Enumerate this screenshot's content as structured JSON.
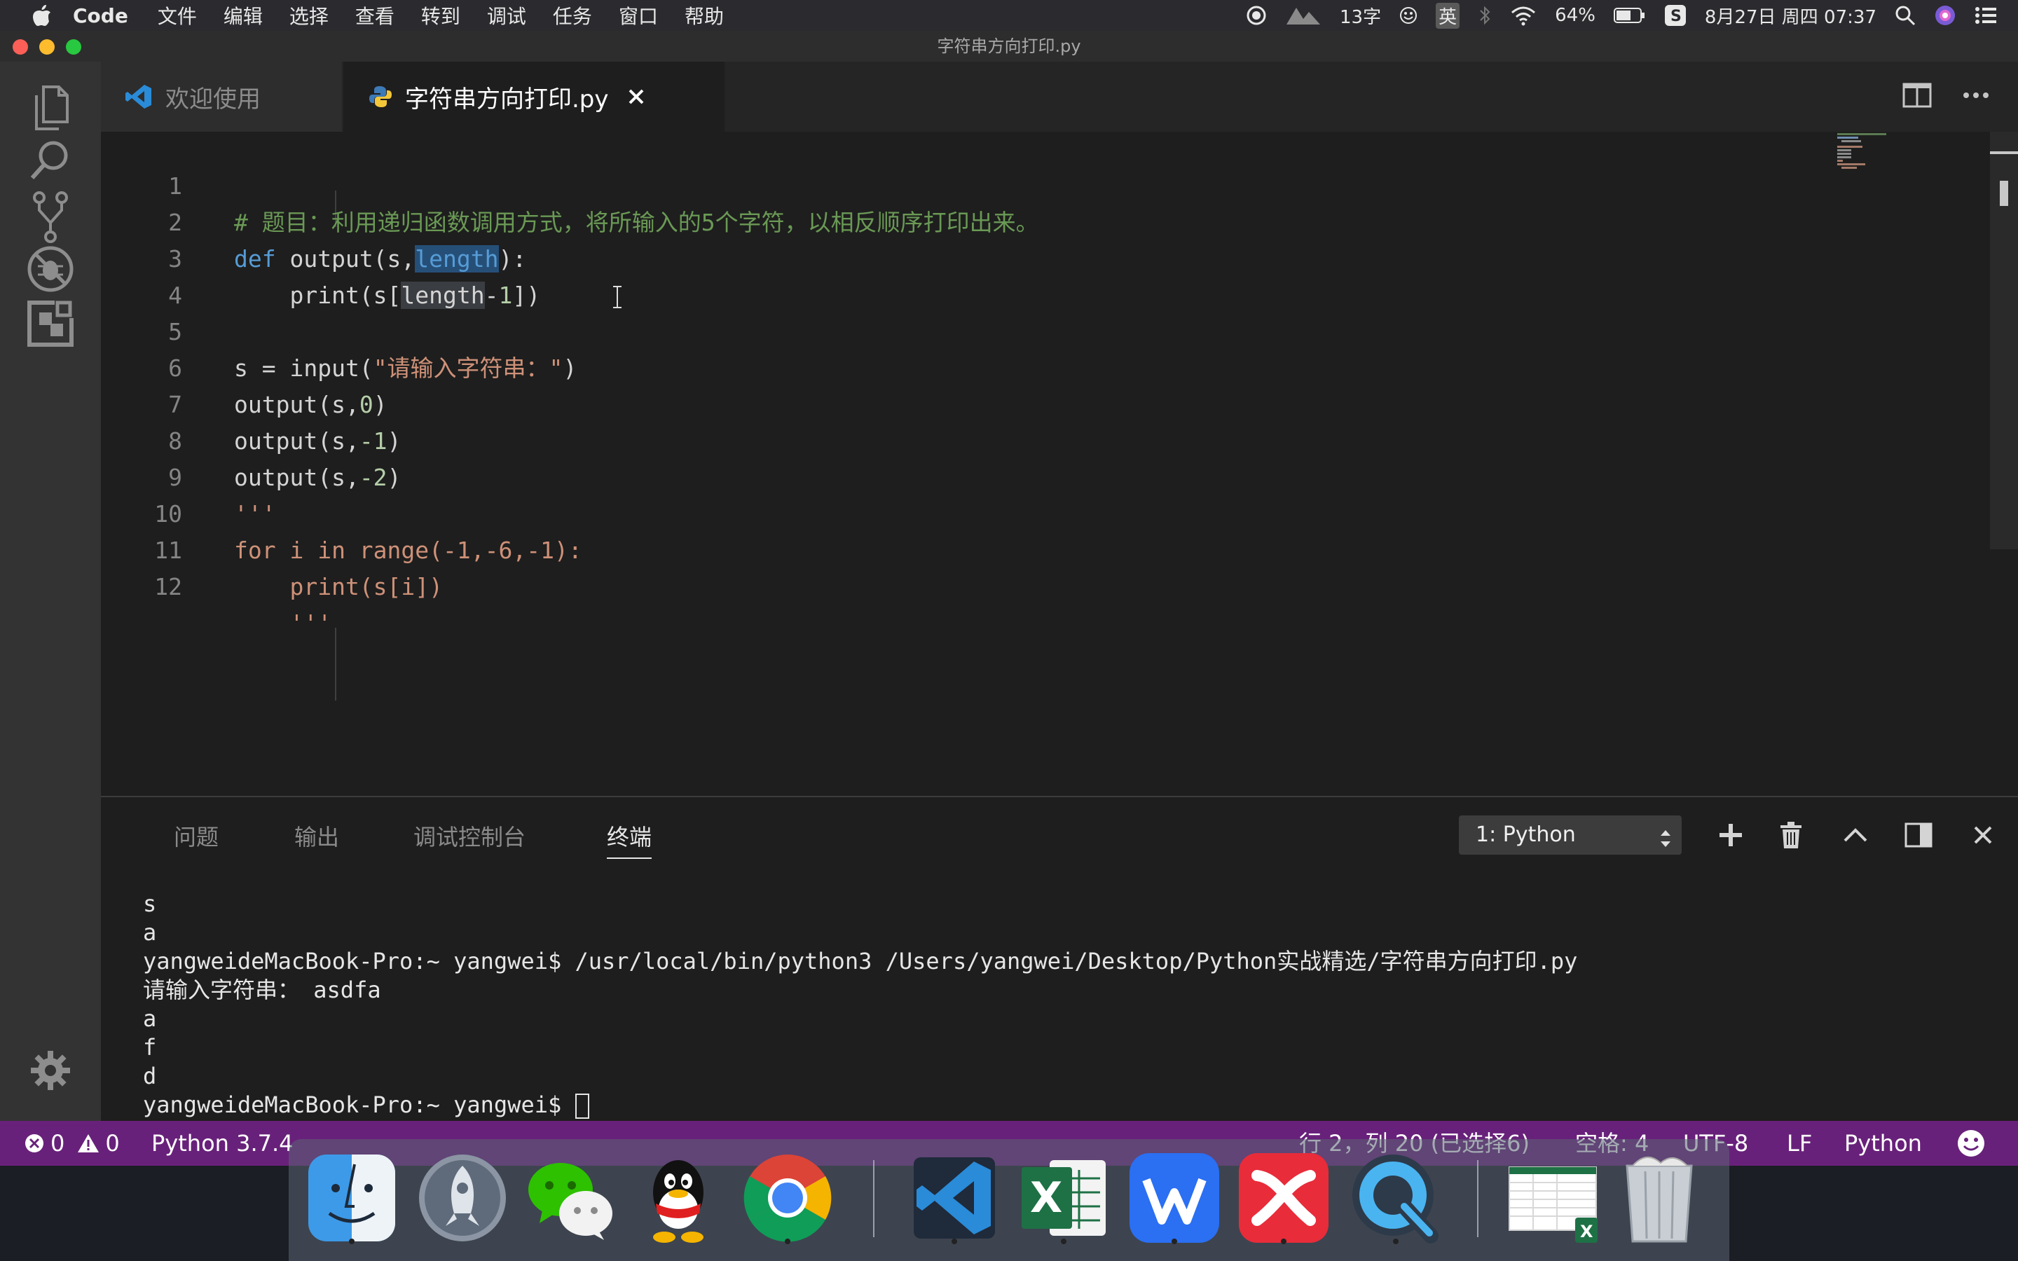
{
  "menubar": {
    "app_name": "Code",
    "items": [
      "文件",
      "编辑",
      "选择",
      "查看",
      "转到",
      "调试",
      "任务",
      "窗口",
      "帮助"
    ],
    "word_count": "13字",
    "input_method": "英",
    "battery": "64%",
    "datetime": "8月27日 周四  07:37"
  },
  "window": {
    "title": "字符串方向打印.py"
  },
  "tabs": {
    "welcome": "欢迎使用",
    "active": "字符串方向打印.py"
  },
  "editor": {
    "line_numbers": [
      "1",
      "2",
      "3",
      "4",
      "5",
      "6",
      "7",
      "8",
      "9",
      "10",
      "11",
      "12"
    ],
    "lines": {
      "l1": "# 题目：利用递归函数调用方式，将所输入的5个字符，以相反顺序打印出来。",
      "l2_def": "def",
      "l2_a": " output(s,",
      "l2_sel": "length",
      "l2_b": "):",
      "l3_a": "    print(s[",
      "l3_len": "length",
      "l3_b": "-",
      "l3_num": "1",
      "l3_c": "])",
      "l5_a": "s = input(",
      "l5_str": "\"请输入字符串：\"",
      "l5_b": ")",
      "l6_a": "output(s,",
      "l6_num": "0",
      "l6_b": ")",
      "l7_a": "output(s,",
      "l7_num": "-1",
      "l7_b": ")",
      "l8_a": "output(s,",
      "l8_num": "-2",
      "l8_b": ")",
      "l9": "'''",
      "l10": "for i in range(-1,-6,-1):",
      "l11": "    print(s[i])",
      "l12": "    '''"
    }
  },
  "panel": {
    "tabs": [
      "问题",
      "输出",
      "调试控制台",
      "终端"
    ],
    "terminal_select": "1: Python",
    "terminal_lines": [
      "s",
      "a",
      "yangweideMacBook-Pro:~ yangwei$ /usr/local/bin/python3 /Users/yangwei/Desktop/Python实战精选/字符串方向打印.py",
      "请输入字符串： asdfa",
      "a",
      "f",
      "d"
    ],
    "prompt": "yangweideMacBook-Pro:~ yangwei$ "
  },
  "statusbar": {
    "errors": "0",
    "warnings": "0",
    "interpreter": "Python 3.7.4",
    "position": "行 2，列 20 (已选择6)",
    "indent": "空格: 4",
    "encoding": "UTF-8",
    "eol": "LF",
    "language": "Python"
  },
  "colors": {
    "statusbar": "#68217a",
    "comment": "#6a9955",
    "keyword": "#569cd6",
    "string": "#ce9178",
    "number": "#b5cea8"
  },
  "dock": {
    "apps": [
      "finder-icon",
      "launchpad-icon",
      "wechat-icon",
      "qq-icon",
      "chrome-icon",
      "vscode-icon",
      "excel-icon",
      "wps-icon",
      "xmind-icon",
      "quicktime-icon",
      "spreadsheet-file-icon",
      "trash-icon"
    ]
  }
}
